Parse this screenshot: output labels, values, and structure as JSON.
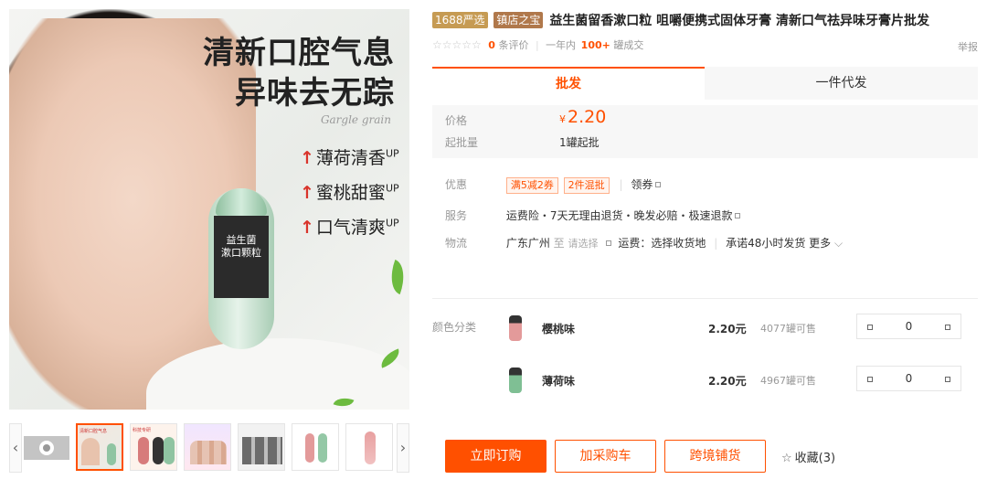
{
  "hero": {
    "headline_line1": "清新口腔气息",
    "headline_line2": "异味去无踪",
    "script_text": "Gargle grain",
    "features": [
      {
        "text": "薄荷清香",
        "sup": "UP"
      },
      {
        "text": "蜜桃甜蜜",
        "sup": "UP"
      },
      {
        "text": "口气清爽",
        "sup": "UP"
      }
    ],
    "bottle_label_line1": "益生菌",
    "bottle_label_line2": "漱口颗粒"
  },
  "gallery": {
    "prev_arrow": "‹",
    "next_arrow": "›",
    "thumb_tags": [
      "清新口腔气息",
      "科技专研",
      "",
      "",
      "",
      ""
    ]
  },
  "product": {
    "badge_1688": "1688严选",
    "badge_shop": "镇店之宝",
    "title": "益生菌留香漱口粒 咀嚼便携式固体牙膏 清新口气祛异味牙膏片批发",
    "stars": "☆☆☆☆☆",
    "review_count": "0",
    "review_suffix": "条评价",
    "sales_prefix": "一年内",
    "sales_count": "100+",
    "sales_suffix": "罐成交",
    "report": "举报"
  },
  "tabs": {
    "wholesale": "批发",
    "dropship": "一件代发"
  },
  "pricing": {
    "price_label": "价格",
    "currency": "¥",
    "price": "2.20",
    "moq_label": "起批量",
    "moq_value": "1罐起批"
  },
  "promo": {
    "label": "优惠",
    "chip1": "满5减2券",
    "chip2": "2件混批",
    "coupon": "领券"
  },
  "service": {
    "label": "服务",
    "text": "运费险・7天无理由退货・晚发必赔・极速退款"
  },
  "logistics": {
    "label": "物流",
    "origin": "广东广州",
    "to": "至",
    "choose": "请选择",
    "freight": "运费：选择收货地",
    "promise": "承诺48小时发货",
    "more": "更多"
  },
  "sku": {
    "label": "颜色分类",
    "items": [
      {
        "name": "樱桃味",
        "price": "2.20元",
        "stock": "4077罐可售",
        "qty": "0",
        "color": "#e39a9a"
      },
      {
        "name": "薄荷味",
        "price": "2.20元",
        "stock": "4967罐可售",
        "qty": "0",
        "color": "#7fbf94"
      }
    ]
  },
  "actions": {
    "buy": "立即订购",
    "cart": "加采购车",
    "cross": "跨境铺货",
    "fav_icon": "☆",
    "fav": "收藏(3)"
  }
}
